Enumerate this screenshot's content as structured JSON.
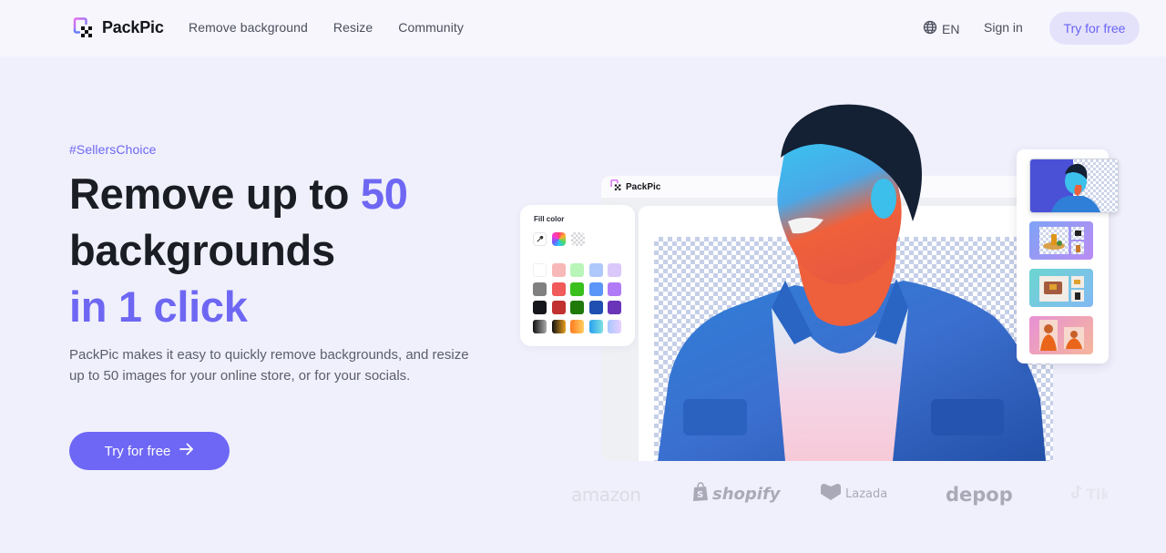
{
  "header": {
    "brand": "PackPic",
    "nav": [
      {
        "label": "Remove background"
      },
      {
        "label": "Resize"
      },
      {
        "label": "Community"
      }
    ],
    "language": {
      "icon": "globe-icon",
      "label": "EN"
    },
    "sign_in": "Sign in",
    "cta": "Try for free"
  },
  "hero": {
    "tag": "#SellersChoice",
    "headline": {
      "line1_prefix": "Remove up to ",
      "line1_accent": "50",
      "line2": "backgrounds",
      "line3_accent": "in 1 click"
    },
    "description": "PackPic makes it easy to quickly remove backgrounds, and resize up to 50 images for your online store, or for your socials.",
    "cta": "Try for free",
    "cta_icon": "arrow-right-icon"
  },
  "editor_mockup": {
    "brand": "PackPic",
    "fill_panel": {
      "title": "Fill color",
      "tools": [
        "eyedropper-icon",
        "color-wheel-icon",
        "transparent-icon"
      ],
      "swatches": [
        "#ffffff",
        "#f9b8b8",
        "#b9f5b9",
        "#aec8fb",
        "#dbc8fb",
        "#808080",
        "#f05a5a",
        "#3bbf1c",
        "#5b95f7",
        "#b17af7",
        "#15171c",
        "#c0312f",
        "#1f7a0a",
        "#1f4fb0",
        "#6a35b8",
        "linear-gradient(90deg,#111,#aaa)",
        "linear-gradient(90deg,#111,#e8a020)",
        "linear-gradient(90deg,#ff7a20,#ffd060)",
        "linear-gradient(90deg,#2aa0f0,#7de0e0)",
        "linear-gradient(90deg,#a8c8ff,#e8d0ff)"
      ]
    },
    "thumbnails": [
      {
        "name": "portrait-thumbnail"
      },
      {
        "name": "product-bottles-thumbnail"
      },
      {
        "name": "product-layout-thumbnail"
      },
      {
        "name": "orange-hoodie-thumbnail"
      }
    ]
  },
  "brands": [
    {
      "label": "amazon"
    },
    {
      "label": "shopify"
    },
    {
      "label": "Lazada"
    },
    {
      "label": "depop"
    },
    {
      "label": "TikTok"
    }
  ],
  "colors": {
    "accent": "#6e67f5",
    "accent_soft": "#e4e2fb",
    "background": "#f0f0fc",
    "text": "#1b1d24",
    "muted": "#5b5e6b"
  }
}
